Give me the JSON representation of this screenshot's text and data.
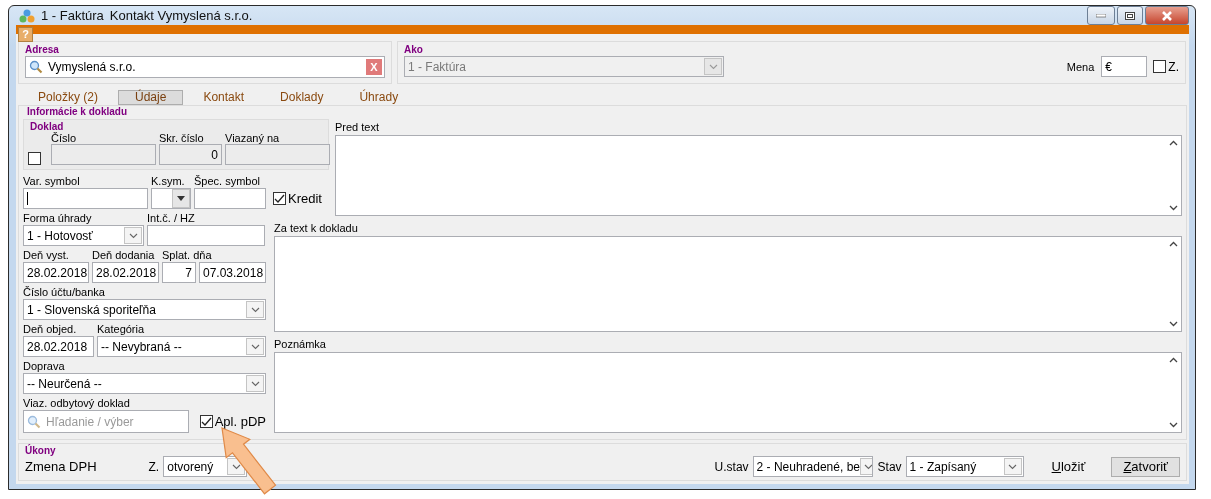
{
  "window": {
    "title": "1 - Faktúra",
    "subtitle": "Kontakt Vymyslená s.r.o."
  },
  "help": "?",
  "address": {
    "label": "Adresa",
    "value": "Vymyslená s.r.o.",
    "clear": "X"
  },
  "ako": {
    "label": "Ako",
    "value": "1 - Faktúra",
    "disabled": true
  },
  "currency": {
    "label": "Mena",
    "value": "€",
    "checkbox": {
      "label": "Z.",
      "checked": false
    }
  },
  "tabs": [
    {
      "label": "Položky (2)",
      "selected": false
    },
    {
      "label": "Údaje",
      "selected": true
    },
    {
      "label": "Kontakt",
      "selected": false
    },
    {
      "label": "Doklady",
      "selected": false
    },
    {
      "label": "Úhrady",
      "selected": false
    }
  ],
  "info": {
    "title": "Informácie k dokladu",
    "doklad": {
      "title": "Doklad",
      "checked": false,
      "fields": [
        {
          "label": "Číslo"
        },
        {
          "label": "Skr. číslo",
          "value": "0"
        },
        {
          "label": "Viazaný na"
        }
      ]
    },
    "rows": [
      [
        {
          "kind": "text",
          "label": "Var. symbol",
          "focused": true
        },
        {
          "kind": "combo",
          "label": "K.sym."
        },
        {
          "kind": "text",
          "label": "Špec. symbol"
        },
        {
          "kind": "check",
          "label": "Kredit",
          "checked": true
        }
      ],
      [
        {
          "kind": "select",
          "label": "Forma úhrady",
          "value": "1 - Hotovosť"
        },
        {
          "kind": "text",
          "label": "Int.č. / HZ"
        }
      ],
      [
        {
          "kind": "text",
          "label": "Deň vyst.",
          "value": "28.02.2018"
        },
        {
          "kind": "text",
          "label": "Deň dodania",
          "value": "28.02.2018"
        },
        {
          "kind": "due",
          "label": "Splat. dňa",
          "days": "7",
          "date": "07.03.2018"
        }
      ],
      [
        {
          "kind": "select",
          "label": "Číslo účtu/banka",
          "value": "1 - Slovenská sporiteľňa"
        }
      ],
      [
        {
          "kind": "text",
          "label": "Deň objed.",
          "value": "28.02.2018"
        },
        {
          "kind": "select",
          "label": "Kategória",
          "value": "-- Nevybraná --"
        }
      ],
      [
        {
          "kind": "select",
          "label": "Doprava",
          "value": "-- Neurčená --"
        }
      ],
      [
        {
          "kind": "search",
          "label": "Viaz. odbytový doklad",
          "placeholder": "Hľadanie / výber",
          "check": {
            "label": "Apl. pDP",
            "checked": true
          }
        }
      ]
    ],
    "notes": [
      {
        "label": "Pred text"
      },
      {
        "label": "Za text k dokladu"
      },
      {
        "label": "Poznámka"
      }
    ]
  },
  "actions": {
    "title": "Úkony",
    "vat_label": "Zmena DPH",
    "z_label": "Z.",
    "z_value": "otvorený",
    "payment_state": {
      "label": "U.stav",
      "value": "2 - Neuhradené, be"
    },
    "state": {
      "label": "Stav",
      "value": "1 - Zapísaný"
    },
    "buttons": [
      {
        "label": "Uložiť",
        "kind": "flat"
      },
      {
        "label": "Zatvoriť",
        "kind": "raised"
      }
    ]
  }
}
